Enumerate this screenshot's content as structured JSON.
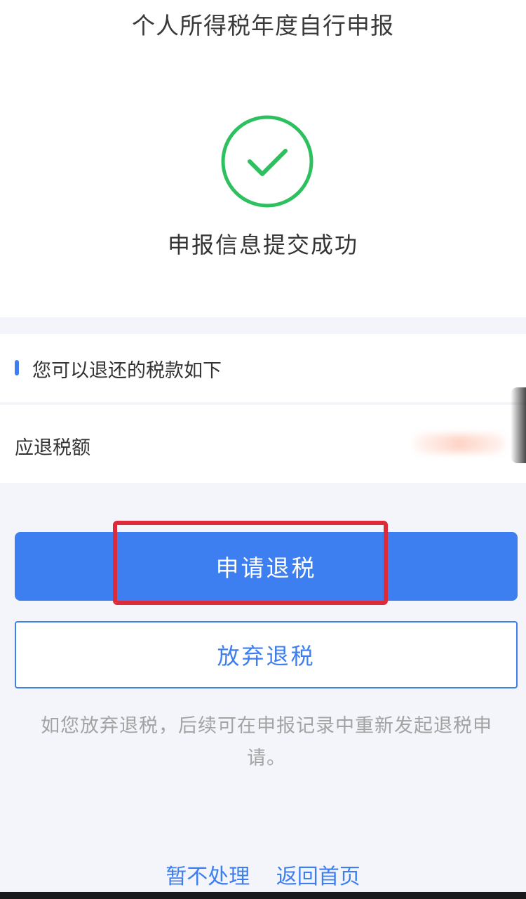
{
  "header": {
    "title": "个人所得税年度自行申报"
  },
  "result": {
    "icon": "success-check-icon",
    "icon_color": "#2cc05f",
    "message": "申报信息提交成功"
  },
  "refund_section": {
    "title": "您可以退还的税款如下",
    "amount_label": "应退税额"
  },
  "actions": {
    "apply_label": "申请退税",
    "abandon_label": "放弃退税",
    "hint": "如您放弃退税，后续可在申报记录中重新发起退税申请。"
  },
  "footer": {
    "later_label": "暂不处理",
    "home_label": "返回首页"
  },
  "colors": {
    "primary": "#3d7ef0",
    "highlight": "#dd2b3a",
    "success": "#2cc05f"
  }
}
